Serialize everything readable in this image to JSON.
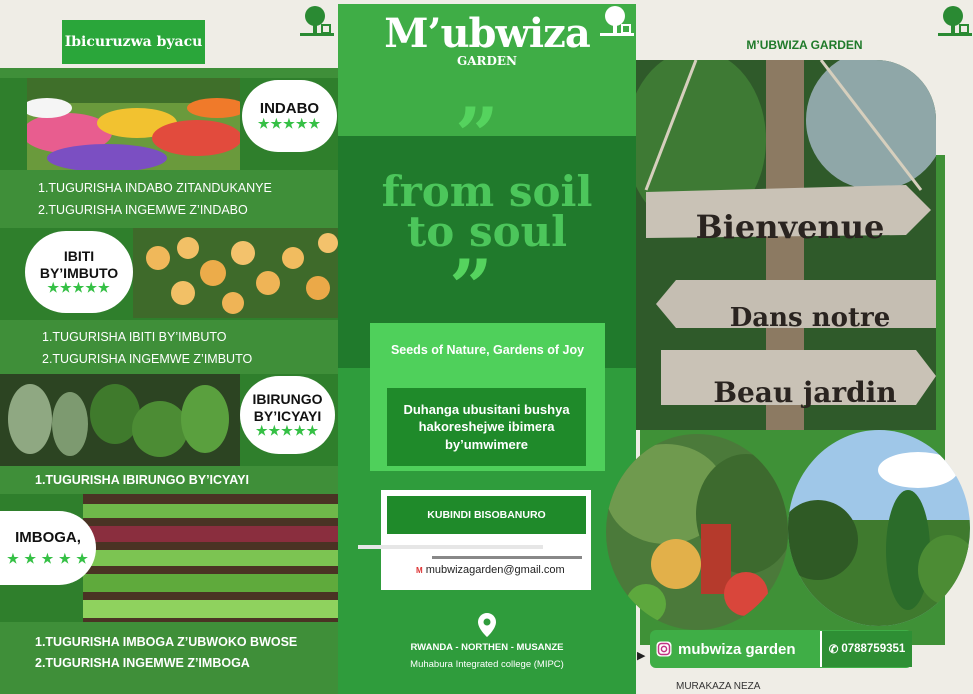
{
  "left": {
    "tab_title": "Ibicuruzwa byacu",
    "sections": [
      {
        "title": "INDABO",
        "stars": "★★★★★",
        "items": [
          "1.TUGURISHA INDABO  ZITANDUKANYE",
          "2.TUGURISHA INGEMWE Z’INDABO"
        ]
      },
      {
        "title_line1": "IBITI",
        "title_line2": "BY’IMBUTO",
        "stars": "★★★★★",
        "items": [
          "1.TUGURISHA IBITI BY’IMBUTO",
          "2.TUGURISHA INGEMWE Z’IMBUTO"
        ]
      },
      {
        "title_line1": "IBIRUNGO",
        "title_line2": "BY’ICYAYI",
        "stars": "★★★★★",
        "items": [
          "1.TUGURISHA IBIRUNGO BY’ICYAYI"
        ]
      },
      {
        "title": "IMBOGA,",
        "stars": "★ ★ ★ ★ ★",
        "items": [
          "1.TUGURISHA IMBOGA Z’UBWOKO BWOSE",
          "2.TUGURISHA INGEMWE Z’IMBOGA"
        ]
      }
    ]
  },
  "middle": {
    "brand": "M’ubwiza",
    "brand_sub": "GARDEN",
    "quote_open": "”",
    "quote_close": "”",
    "slogan_line1": "from soil",
    "slogan_line2": "to soul",
    "tagline": "Seeds of Nature, Gardens of Joy",
    "description": "Duhanga ubusitani bushya hakoreshejwe ibimera by’umwimere",
    "more_button": "KUBINDI BISOBANURO",
    "email_icon": "M",
    "email": "mubwizagarden@gmail.com",
    "address_line1": "RWANDA - NORTHEN - MUSANZE",
    "address_line2": "Muhabura Integrated college  (MIPC)"
  },
  "right": {
    "title": "M’UBWIZA GARDEN",
    "sign_line1": "Bienvenue",
    "sign_line2": "Dans notre",
    "sign_line3": "Beau jardin",
    "instagram": "mubwiza garden",
    "phone": "0788759351",
    "welcome": "MURAKAZA NEZA"
  },
  "colors": {
    "brand_green": "#2f9c3c",
    "dark_green": "#207a2c",
    "light_green": "#4fd05b",
    "star_green": "#35c045"
  }
}
